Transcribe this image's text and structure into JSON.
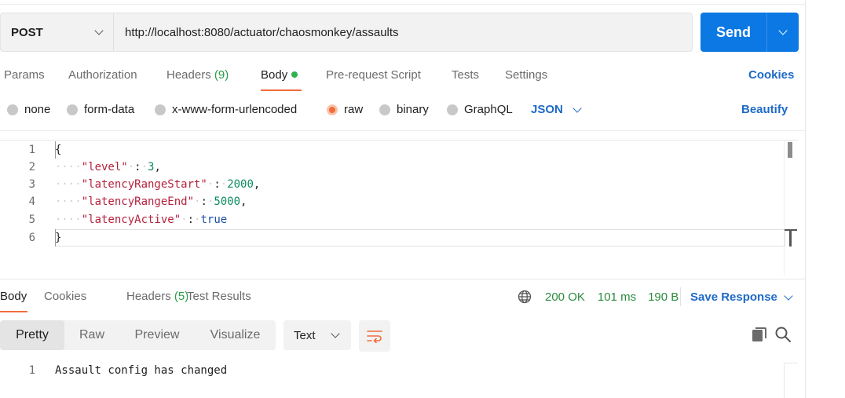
{
  "request": {
    "method": "POST",
    "url": "http://localhost:8080/actuator/chaosmonkey/assaults",
    "send_label": "Send"
  },
  "request_tabs": [
    {
      "label": "Params"
    },
    {
      "label": "Authorization"
    },
    {
      "label": "Headers",
      "count": "(9)"
    },
    {
      "label": "Body",
      "active": true
    },
    {
      "label": "Pre-request Script"
    },
    {
      "label": "Tests"
    },
    {
      "label": "Settings"
    }
  ],
  "cookies_label": "Cookies",
  "body_types": [
    {
      "label": "none"
    },
    {
      "label": "form-data"
    },
    {
      "label": "x-www-form-urlencoded"
    },
    {
      "label": "raw",
      "selected": true
    },
    {
      "label": "binary"
    },
    {
      "label": "GraphQL"
    }
  ],
  "body_format": "JSON",
  "beautify_label": "Beautify",
  "editor": {
    "lines": [
      {
        "n": "1",
        "text": "{"
      },
      {
        "n": "2",
        "key": "\"level\"",
        "value": "3",
        "value_type": "num",
        "comma": ","
      },
      {
        "n": "3",
        "key": "\"latencyRangeStart\"",
        "value": "2000",
        "value_type": "num",
        "comma": ","
      },
      {
        "n": "4",
        "key": "\"latencyRangeEnd\"",
        "value": "5000",
        "value_type": "num",
        "comma": ","
      },
      {
        "n": "5",
        "key": "\"latencyActive\"",
        "value": "true",
        "value_type": "kw",
        "comma": ""
      },
      {
        "n": "6",
        "text": "}"
      }
    ]
  },
  "response_tabs": [
    {
      "label": "Body",
      "active": true
    },
    {
      "label": "Cookies"
    },
    {
      "label": "Headers",
      "count": "(5)"
    },
    {
      "label": "Test Results"
    }
  ],
  "response_status": {
    "status": "200 OK",
    "time": "101 ms",
    "size": "190 B"
  },
  "save_response_label": "Save Response",
  "view_modes": [
    "Pretty",
    "Raw",
    "Preview",
    "Visualize"
  ],
  "active_view": "Pretty",
  "response_format": "Text",
  "response_body": {
    "n": "1",
    "text": "Assault config has changed"
  },
  "colors": {
    "accent": "#f26b3a",
    "send": "#0b78e3",
    "link": "#1e6ac7",
    "status_ok": "#2a8a3e"
  }
}
